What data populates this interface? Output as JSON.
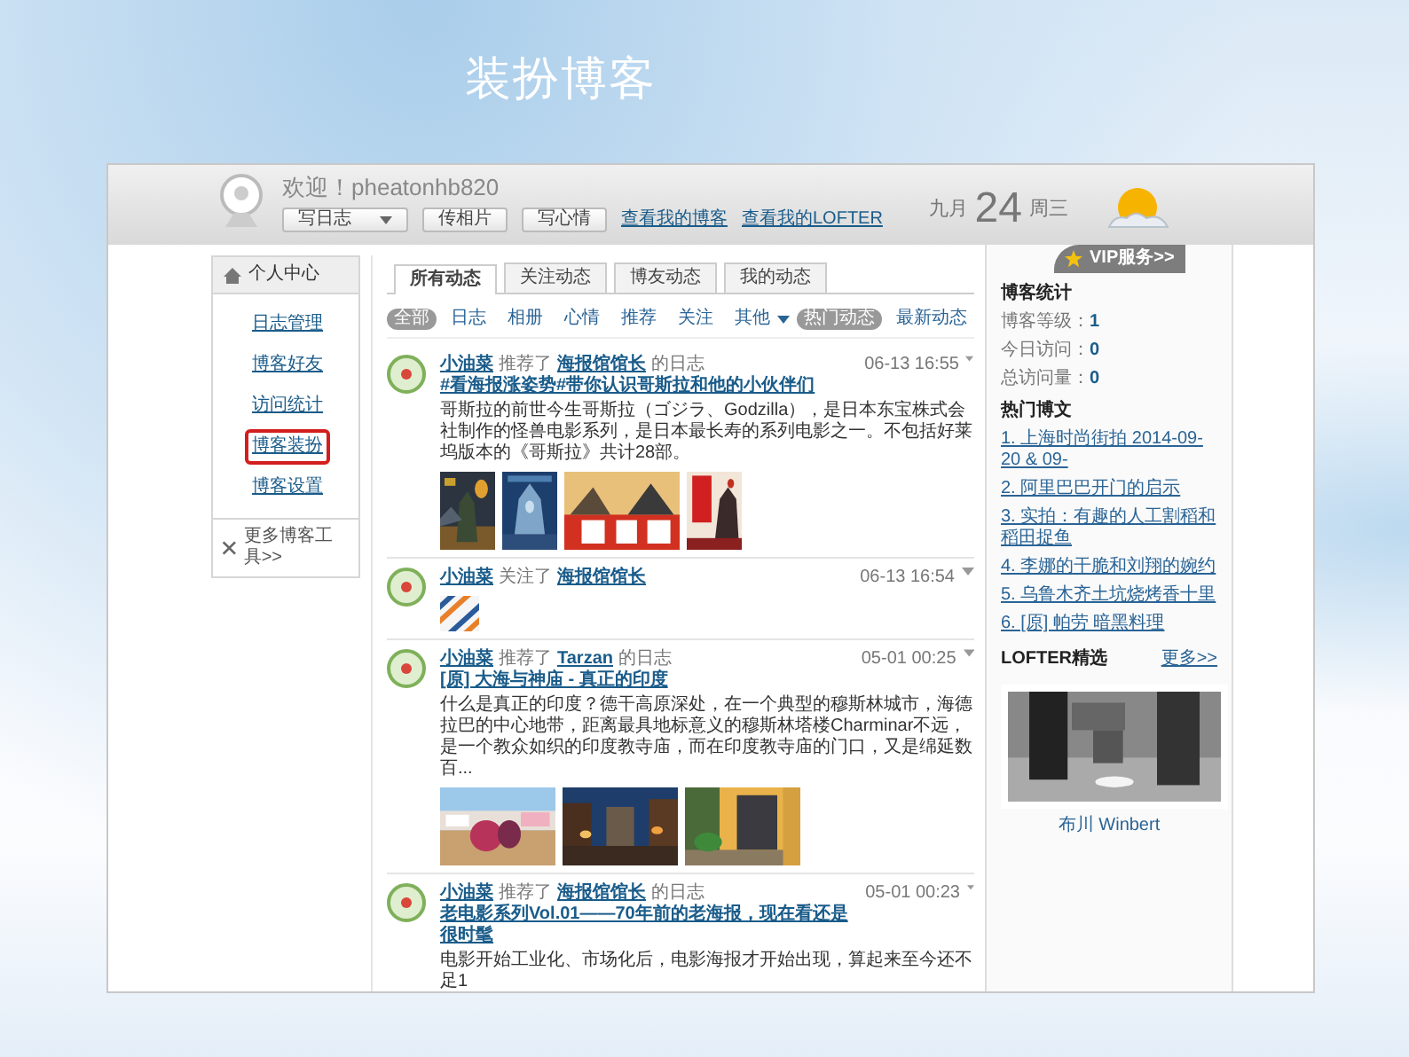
{
  "slide_title": "装扮博客",
  "header": {
    "welcome": "欢迎！pheatonhb820",
    "buttons": [
      {
        "label": "写日志",
        "dropdown": true
      },
      {
        "label": "传相片",
        "dropdown": false
      },
      {
        "label": "写心情",
        "dropdown": false
      }
    ],
    "links": [
      "查看我的博客",
      "查看我的LOFTER"
    ],
    "date": {
      "month": "九月",
      "day": "24",
      "weekday": "周三"
    }
  },
  "sidebar": {
    "title": "个人中心",
    "items": [
      {
        "label": "日志管理",
        "highlighted": false
      },
      {
        "label": "博客好友",
        "highlighted": false
      },
      {
        "label": "访问统计",
        "highlighted": false
      },
      {
        "label": "博客装扮",
        "highlighted": true
      },
      {
        "label": "博客设置",
        "highlighted": false
      }
    ],
    "more": "更多博客工具>>"
  },
  "tabs": [
    {
      "label": "所有动态",
      "selected": true
    },
    {
      "label": "关注动态",
      "selected": false
    },
    {
      "label": "博友动态",
      "selected": false
    },
    {
      "label": "我的动态",
      "selected": false
    }
  ],
  "filters": [
    {
      "label": "全部",
      "selected": true,
      "dropdown": false
    },
    {
      "label": "日志",
      "selected": false,
      "dropdown": false
    },
    {
      "label": "相册",
      "selected": false,
      "dropdown": false
    },
    {
      "label": "心情",
      "selected": false,
      "dropdown": false
    },
    {
      "label": "推荐",
      "selected": false,
      "dropdown": false
    },
    {
      "label": "关注",
      "selected": false,
      "dropdown": false
    },
    {
      "label": "其他",
      "selected": false,
      "dropdown": true
    }
  ],
  "sort": [
    {
      "label": "热门动态",
      "selected": true
    },
    {
      "label": "最新动态",
      "selected": false
    }
  ],
  "posts": [
    {
      "user": "小油菜",
      "action": "推荐了",
      "author": "海报馆馆长",
      "source": "的日志",
      "title": "#看海报涨姿势#带你认识哥斯拉和他的小伙伴们",
      "time": "06-13 16:55",
      "text": "哥斯拉的前世今生哥斯拉（ゴジラ、Godzilla），是日本东宝株式会社制作的怪兽电影系列，是日本最长寿的系列电影之一。不包括好莱坞版本的《哥斯拉》共计28部。",
      "images": [
        {
          "kind": "picture"
        },
        {
          "kind": "picture"
        },
        {
          "kind": "picture"
        },
        {
          "kind": "picture"
        }
      ]
    },
    {
      "user": "小油菜",
      "action": "关注了",
      "author": "海报馆馆长",
      "time": "06-13 16:54",
      "images": [
        {
          "kind": "picture"
        }
      ]
    },
    {
      "user": "小油菜",
      "action": "推荐了",
      "author": "Tarzan",
      "source": "的日志",
      "title": "[原] 大海与神庙 - 真正的印度",
      "time": "05-01 00:25",
      "text": "什么是真正的印度？德干高原深处，在一个典型的穆斯林城市，海德拉巴的中心地带，距离最具地标意义的穆斯林塔楼Charminar不远，是一个教众如织的印度教寺庙，而在印度教寺庙的门口，又是绵延数百...",
      "images": [
        {
          "kind": "picture"
        },
        {
          "kind": "picture"
        },
        {
          "kind": "picture"
        }
      ]
    },
    {
      "user": "小油菜",
      "action": "推荐了",
      "author": "海报馆馆长",
      "source": "的日志",
      "title": "老电影系列Vol.01——70年前的老海报，现在看还是很时髦",
      "time": "05-01 00:23",
      "text": "电影开始工业化、市场化后，电影海报才开始出现，算起来至今还不足1"
    }
  ],
  "right": {
    "vip": "VIP服务>>",
    "stats_title": "博客统计",
    "stats": [
      {
        "label": "博客等级：",
        "value": "1"
      },
      {
        "label": "今日访问：",
        "value": "0"
      },
      {
        "label": "总访问量：",
        "value": "0"
      }
    ],
    "hot_title": "热门博文",
    "hot": [
      "1. 上海时尚街拍 2014-09-20 & 09-",
      "2. 阿里巴巴开门的启示",
      "3. 实拍：有趣的人工割稻和稻田捉鱼",
      "4. 李娜的干脆和刘翔的婉约",
      "5. 乌鲁木齐土坑烧烤香十里",
      "6. [原] 帕劳 暗黑料理"
    ],
    "lofter_title": "LOFTER精选",
    "more": "更多>>",
    "caption": "布川 Winbert",
    "photo": {
      "kind": "picture"
    }
  }
}
